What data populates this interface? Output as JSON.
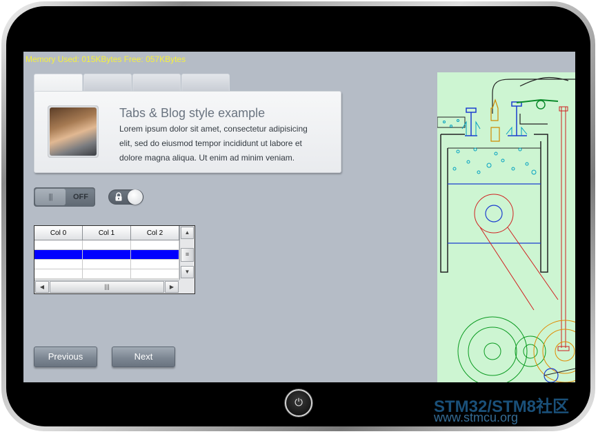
{
  "status": {
    "memory": "Memory Used: 015KBytes Free: 057KBytes"
  },
  "tabs": [
    {
      "label": ""
    },
    {
      "label": ""
    },
    {
      "label": ""
    },
    {
      "label": ""
    }
  ],
  "blog": {
    "title": "Tabs & Blog style example",
    "body": "Lorem ipsum dolor sit amet, consectetur adipisicing elit, sed do eiusmod tempor incididunt ut labore et dolore magna aliqua. Ut enim ad minim veniam."
  },
  "toggle": {
    "state_label": "OFF",
    "lock_on": true
  },
  "table": {
    "columns": [
      "Col 0",
      "Col 1",
      "Col 2"
    ],
    "selected_row": 1
  },
  "buttons": {
    "previous": "Previous",
    "next": "Next"
  },
  "watermark": {
    "line1": "STM32/STM8社区",
    "line2": "www.stmcu.org"
  },
  "colors": {
    "screen_bg": "#b5bcc6",
    "memory_text": "#f7f13a",
    "selection": "#0000ff",
    "engine_bg": "#cdf5d2"
  },
  "icons": {
    "power": "power-icon",
    "lock": "lock-icon"
  }
}
